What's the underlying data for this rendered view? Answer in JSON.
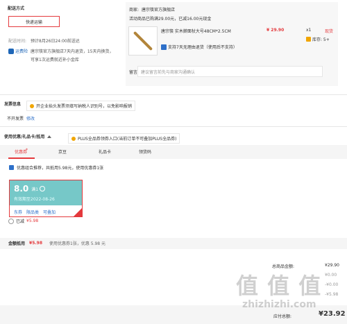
{
  "shipping": {
    "title": "配送方式",
    "method_label": "快递运输",
    "time_label": "配送时间:",
    "time_value": "预计8月26日24:00前送达",
    "policy_badge": "运费险",
    "policy_text": "唐宗筷官方旗舰店7天内退货，15天内换货，可享1次运费就近补小金库"
  },
  "merchant": {
    "label": "商家:",
    "name": "唐宗筷官方旗舰店",
    "promo": "活动商品已购满29.00元，已减16.00元现金",
    "product_title": "唐宗筷 实木擀面杖大号48CM*2.5CM",
    "price": "¥ 29.90",
    "qty": "x1",
    "stock": "库存: 5+",
    "return_note": "支持7天无理由退货（使用后不支持）",
    "remark_label": "留言:",
    "remark_placeholder": "建议留言前先与商家沟通确认",
    "link1": "现货",
    "link2": "库存: 5+"
  },
  "invoice": {
    "title": "发票信息",
    "tip": "开企业抬头发票须填写纳税人识别号，以免影响报销",
    "value": "不开发票",
    "edit": "修改"
  },
  "coupons": {
    "title": "使用优惠/礼品卡/抵用",
    "plus_tip": "PLUS全品券领券入口(当前订单不可叠加PLUS全品券)",
    "tabs": [
      "优惠券",
      "京豆",
      "礼品卡",
      "领货码"
    ],
    "combo_text": "优惠组合推荐，共抵用5.98元，使用优惠券1张",
    "coupon": {
      "amount": "8.0",
      "unit": "满1",
      "expire": "有效期至2022-08-26",
      "tags": [
        "东券",
        "限品类",
        "可叠加"
      ]
    },
    "used_text": "已减",
    "used_amount": "¥5.98"
  },
  "amount_row": {
    "label": "金额抵用",
    "value": "¥5.98",
    "desc": "使用优惠券1张，优惠 5.98 元"
  },
  "summary": {
    "total_label": "总商品金额:",
    "total_value": "¥29.90",
    "line2_value": "¥0.00",
    "line3_value": "-¥0.00",
    "line4_value": "-¥5.98",
    "pay_label": "应付总额:",
    "pay_value": "¥23.92"
  },
  "watermark": "值 值 值",
  "watermark_url": "zhizhizhi.com",
  "colors": {
    "accent": "#e4393c",
    "coupon_bg": "#76c8c8"
  }
}
